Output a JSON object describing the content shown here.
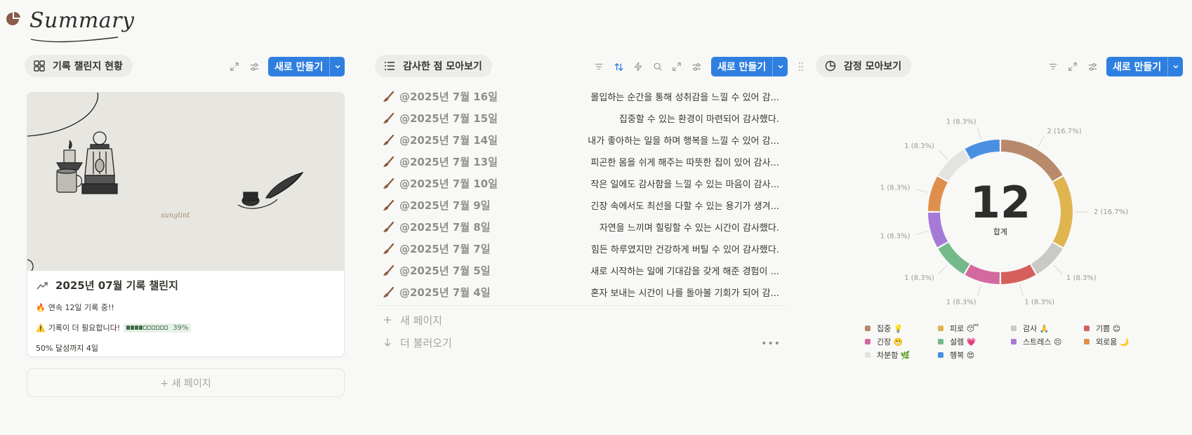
{
  "page": {
    "title": "Summary"
  },
  "left": {
    "view_label": "기록 챌린지 현황",
    "new_button": "새로 만들기",
    "card": {
      "title": "2025년 07월 기록 챌린지",
      "streak_emoji": "🔥",
      "streak_text": "연속 12일 기록 중!!",
      "warn_emoji": "⚠️",
      "warn_text": "기록이 더 필요합니다!",
      "progress": 0.39,
      "progress_label": "39%",
      "goal_text": "50% 달성까지 4일",
      "cover_watermark": "sunglint"
    },
    "add_page": "+ 새 페이지"
  },
  "middle": {
    "view_label": "감사한 점 모아보기",
    "new_button": "새로 만들기",
    "rows": [
      {
        "date": "@2025년 7월 16일",
        "text": "몰입하는 순간을 통해 성취감을 느낄 수 있어 감..."
      },
      {
        "date": "@2025년 7월 15일",
        "text": "집중할 수 있는 환경이 마련되어 감사했다."
      },
      {
        "date": "@2025년 7월 14일",
        "text": "내가 좋아하는 일을 하며 행복을 느낄 수 있어 감..."
      },
      {
        "date": "@2025년 7월 13일",
        "text": "피곤한 몸을 쉬게 해주는 따뜻한 집이 있어 감사..."
      },
      {
        "date": "@2025년 7월 10일",
        "text": "작은 일에도 감사함을 느낄 수 있는 마음이 감사..."
      },
      {
        "date": "@2025년 7월 9일",
        "text": "긴장 속에서도 최선을 다할 수 있는 용기가 생겨..."
      },
      {
        "date": "@2025년 7월 8일",
        "text": "자연을 느끼며 힐링할 수 있는 시간이 감사했다."
      },
      {
        "date": "@2025년 7월 7일",
        "text": "힘든 하루였지만 건강하게 버틸 수 있어 감사했다."
      },
      {
        "date": "@2025년 7월 5일",
        "text": "새로 시작하는 일에 기대감을 갖게 해준 경험이 ..."
      },
      {
        "date": "@2025년 7월 4일",
        "text": "혼자 보내는 시간이 나를 돌아볼 기회가 되어 감..."
      }
    ],
    "new_page": "새 페이지",
    "load_more": "더 불러오기",
    "more_dots": "•••"
  },
  "right": {
    "view_label": "감정 모아보기",
    "new_button": "새로 만들기",
    "total": "12",
    "total_label": "합계"
  },
  "chart_data": {
    "type": "pie",
    "title": "",
    "total": 12,
    "slices": [
      {
        "name": "집중 💡",
        "value": 2,
        "label": "2 (16.7%)",
        "color": "#b8896a"
      },
      {
        "name": "피로 😴",
        "value": 2,
        "label": "2 (16.7%)",
        "color": "#e0b44e"
      },
      {
        "name": "감사 🙏",
        "value": 1,
        "label": "1 (8.3%)",
        "color": "#c9c9c6"
      },
      {
        "name": "기쁨 😊",
        "value": 1,
        "label": "1 (8.3%)",
        "color": "#d5605b"
      },
      {
        "name": "긴장 😬",
        "value": 1,
        "label": "1 (8.3%)",
        "color": "#d3699f"
      },
      {
        "name": "설렘 💗",
        "value": 1,
        "label": "1 (8.3%)",
        "color": "#74b98a"
      },
      {
        "name": "스트레스 😣",
        "value": 1,
        "label": "1 (8.3%)",
        "color": "#a57ad6"
      },
      {
        "name": "외로움 🌙",
        "value": 1,
        "label": "1 (8.3%)",
        "color": "#df8f4c"
      },
      {
        "name": "차분함 🌿",
        "value": 1,
        "label": "1 (8.3%)",
        "color": "#e3e3e1"
      },
      {
        "name": "행복 😍",
        "value": 1,
        "label": "1 (8.3%)",
        "color": "#4a90e2"
      }
    ],
    "legend_position": "bottom"
  },
  "colors": {
    "accent": "#2f7fe0",
    "brush": "#8b5a3c",
    "pill_bg": "#ececea"
  }
}
